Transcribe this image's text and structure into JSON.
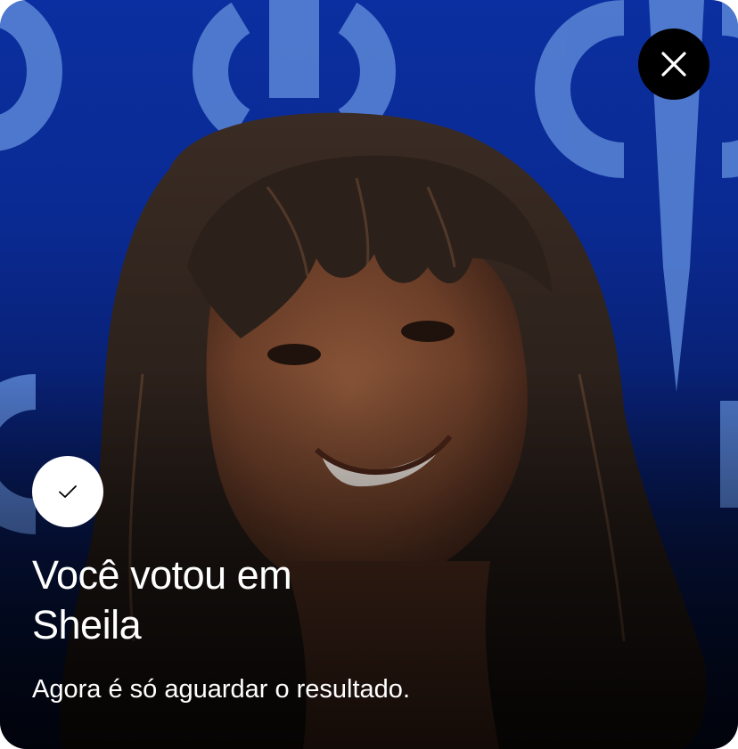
{
  "modal": {
    "title_line1": "Você votou em",
    "title_line2": "Sheila",
    "subtitle": "Agora é só aguardar o resultado.",
    "close_icon": "close-icon",
    "status_icon": "check-icon"
  },
  "colors": {
    "background_top": "#0b2fa0",
    "background_bottom": "#040d2a",
    "logo_pattern": "#5a86d6",
    "close_button_bg": "#000000",
    "check_badge_bg": "#ffffff",
    "text": "#ffffff"
  }
}
